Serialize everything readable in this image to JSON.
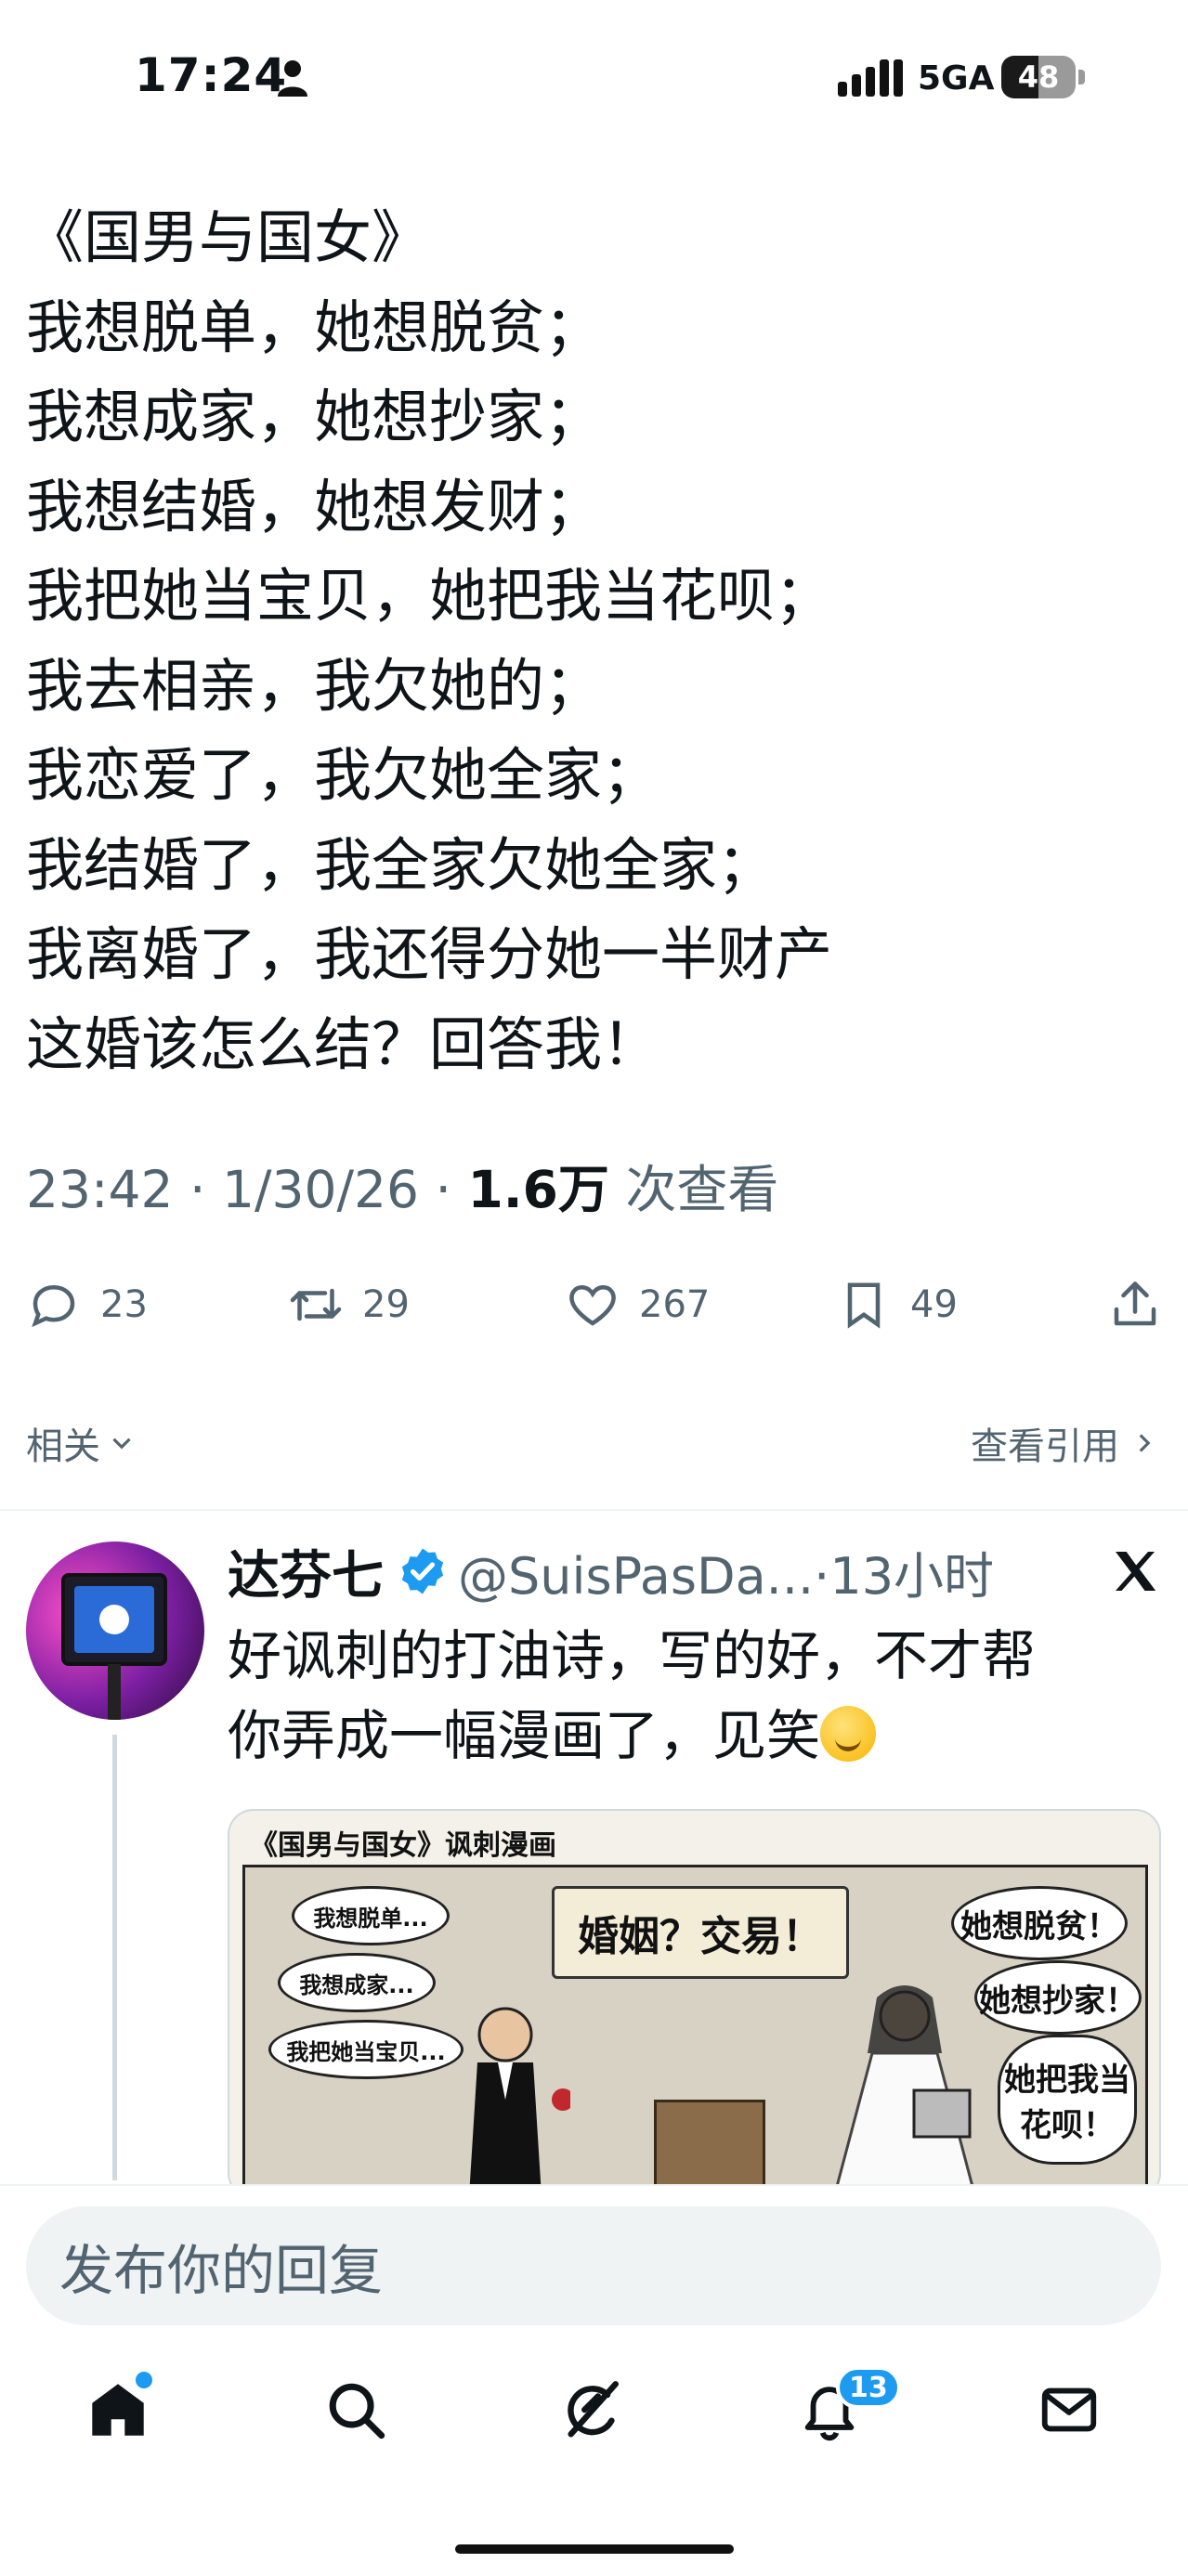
{
  "status_bar": {
    "time": "17:24",
    "network": "5GA",
    "battery": "48"
  },
  "tweet": {
    "lines": [
      "《国男与国女》",
      "我想脱单，她想脱贫；",
      "我想成家，她想抄家；",
      "我想结婚，她想发财；",
      "我把她当宝贝，她把我当花呗；",
      "我去相亲，我欠她的；",
      "我恋爱了，我欠她全家；",
      "我结婚了，我全家欠她全家；",
      "我离婚了，我还得分她一半财产",
      "这婚该怎么结？回答我！"
    ],
    "time": "23:42",
    "date": "1/30/26",
    "views_count": "1.6万",
    "views_label": "次查看",
    "separator": "·"
  },
  "actions": {
    "replies": "23",
    "retweets": "29",
    "likes": "267",
    "bookmarks": "49"
  },
  "related": {
    "label": "相关",
    "view_quotes": "查看引用"
  },
  "reply": {
    "name": "达芬七",
    "handle": "@SuisPasDa...·13小时",
    "lines": [
      "好讽刺的打油诗，写的好，不才帮",
      "你弄成一幅漫画了，见笑"
    ],
    "card": {
      "title": "《国男与国女》讽刺漫画",
      "banner": "婚姻？交易！",
      "left_bubbles": [
        "我想脱单...",
        "我想成家...",
        "我把她当宝贝..."
      ],
      "right_bubbles": [
        "她想脱贫！",
        "她想抄家！",
        "她把我当花呗！"
      ]
    }
  },
  "reply_box": {
    "placeholder": "发布你的回复"
  },
  "nav": {
    "notifications_badge": "13"
  },
  "colors": {
    "accent": "#1d9bf0",
    "muted": "#536471",
    "text": "#0f1419"
  }
}
